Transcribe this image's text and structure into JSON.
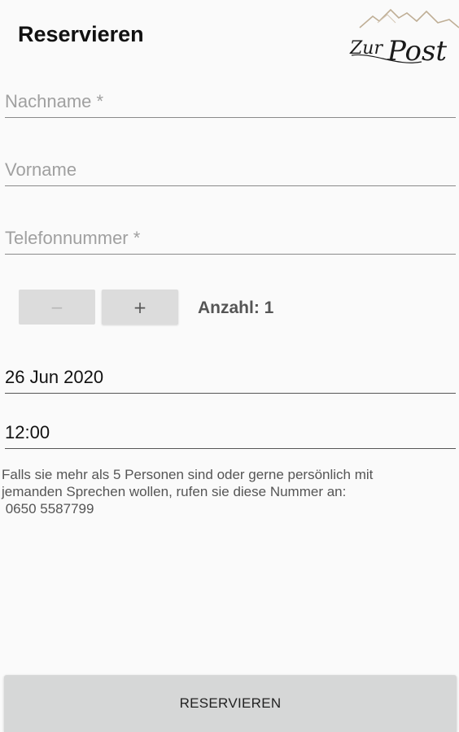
{
  "header": {
    "title": "Reservieren",
    "logo_text": "Zur Post"
  },
  "form": {
    "lastname": {
      "placeholder": "Nachname *",
      "value": ""
    },
    "firstname": {
      "placeholder": "Vorname",
      "value": ""
    },
    "phone": {
      "placeholder": "Telefonnummer *",
      "value": ""
    },
    "stepper": {
      "minus_label": "−",
      "plus_label": "+",
      "count_label": "Anzahl: 1"
    },
    "date": "26 Jun 2020",
    "time": "12:00"
  },
  "info": {
    "line1": "Falls sie mehr als 5 Personen sind oder gerne persönlich mit",
    "line2": "jemanden Sprechen wollen, rufen sie diese Nummer an:",
    "phone": " 0650 5587799"
  },
  "submit_label": "RESERVIEREN"
}
